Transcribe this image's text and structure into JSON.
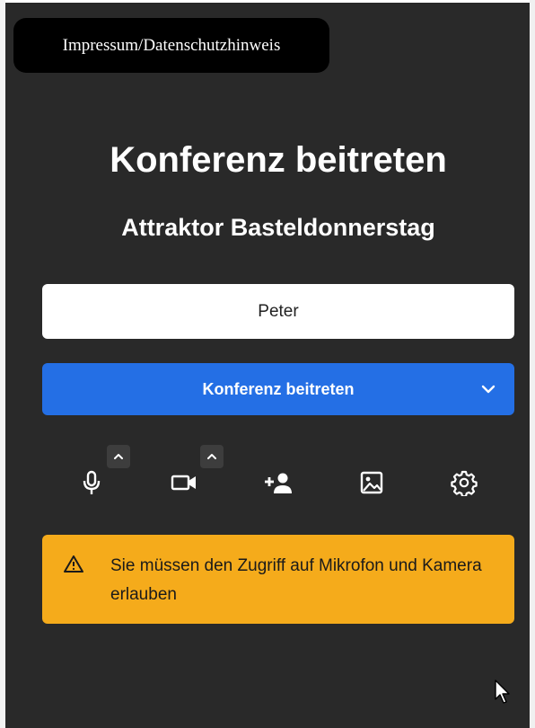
{
  "impressum_label": "Impressum/Datenschutzhinweis",
  "heading": "Konferenz beitreten",
  "room_name": "Attraktor Basteldonnerstag",
  "name_input": {
    "value": "Peter",
    "placeholder": ""
  },
  "join_button": {
    "label": "Konferenz beitreten",
    "options_icon": "chevron-down-icon"
  },
  "toolbar": {
    "microphone": {
      "icon": "microphone-icon",
      "options_icon": "chevron-up-icon"
    },
    "camera": {
      "icon": "camera-icon",
      "options_icon": "chevron-up-icon"
    },
    "invite": {
      "icon": "add-person-icon"
    },
    "background": {
      "icon": "image-icon"
    },
    "settings": {
      "icon": "gear-icon"
    }
  },
  "warning": {
    "icon": "warning-icon",
    "message": "Sie müssen den Zugriff auf Mikrofon und Kamera erlauben"
  },
  "colors": {
    "panel_bg": "#292929",
    "primary_button": "#246fe5",
    "warning_bg": "#f5ab1b"
  }
}
